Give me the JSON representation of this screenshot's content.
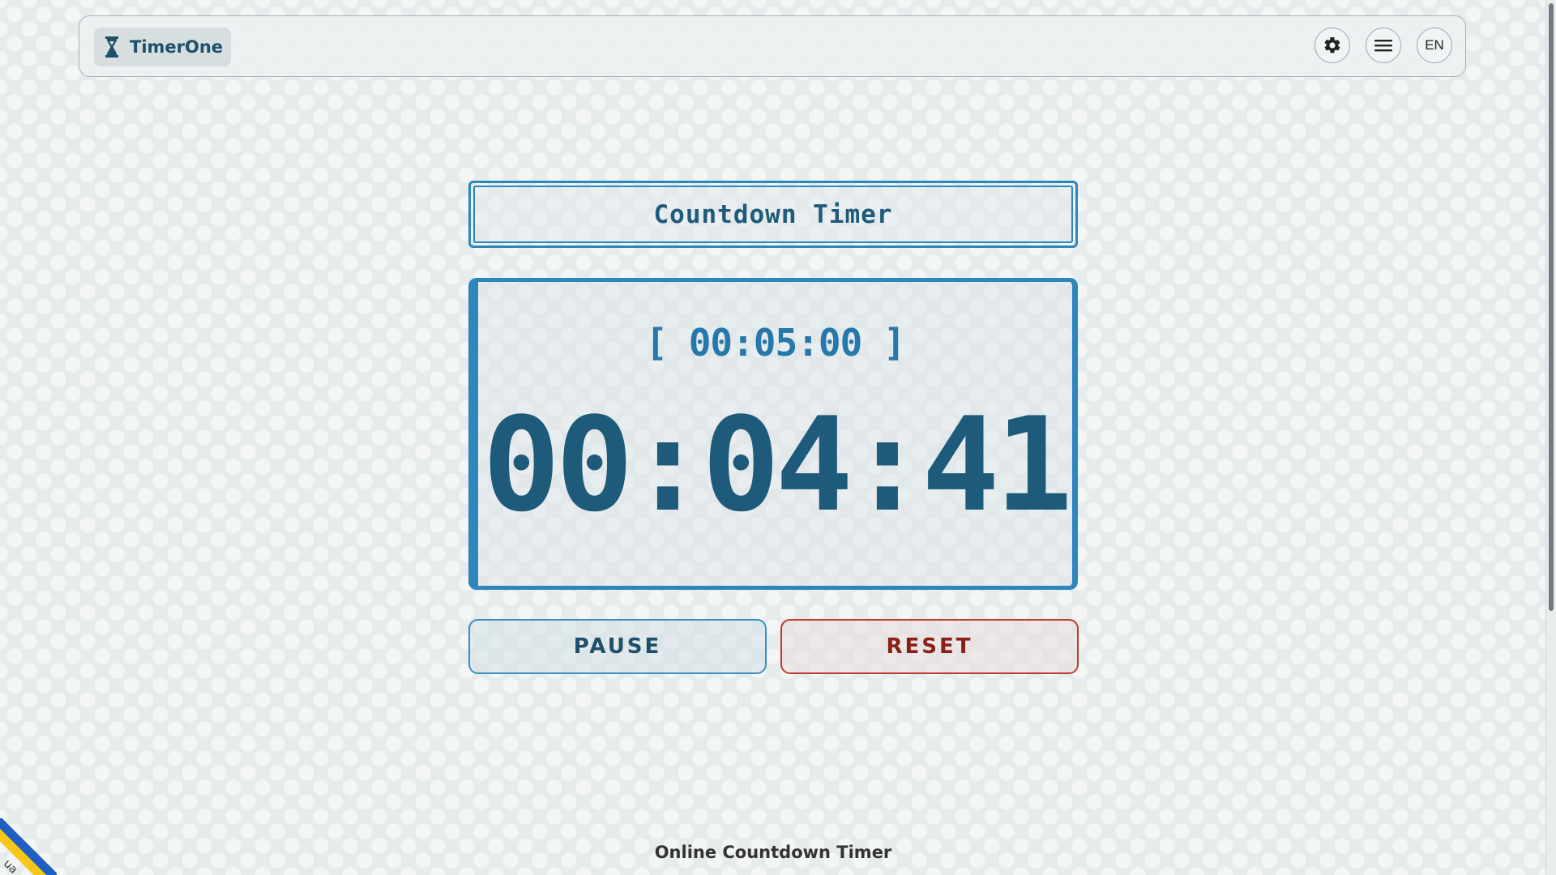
{
  "app": {
    "brand_name": "TimerOne",
    "brand_icon": "hourglass-icon"
  },
  "header": {
    "settings_icon": "gear-icon",
    "menu_icon": "hamburger-menu-icon",
    "language_label": "EN"
  },
  "main": {
    "title": "Countdown Timer",
    "target_time": "[ 00:05:00 ]",
    "remaining_time": "00:04:41",
    "pause_label": "PAUSE",
    "reset_label": "RESET"
  },
  "footer": {
    "text": "Online Countdown Timer"
  },
  "corner_badge": {
    "label": "ua",
    "colors": [
      "#1f5fc2",
      "#f5c518"
    ]
  },
  "colors": {
    "accent": "#2e86bd",
    "text_dark_blue": "#1e5a7a",
    "reset_red": "#c0392b",
    "background": "#e6eceb"
  }
}
